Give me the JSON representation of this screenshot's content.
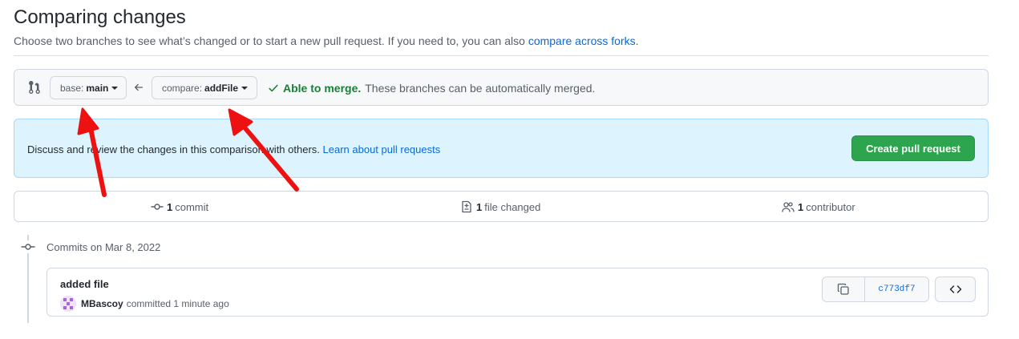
{
  "header": {
    "title": "Comparing changes",
    "subtitle_text": "Choose two branches to see what’s changed or to start a new pull request. If you need to, you can also ",
    "subtitle_link": "compare across forks",
    "subtitle_end": "."
  },
  "range": {
    "base_prefix": "base:",
    "base_branch": "main",
    "compare_prefix": "compare:",
    "compare_branch": "addFile",
    "merge_ok": "Able to merge.",
    "merge_text": "These branches can be automatically merged."
  },
  "flash": {
    "text": "Discuss and review the changes in this comparison with others. ",
    "link": "Learn about pull requests",
    "button": "Create pull request"
  },
  "summary": {
    "commits_count": "1",
    "commits_label": "commit",
    "files_count": "1",
    "files_label": "file changed",
    "contributors_count": "1",
    "contributors_label": "contributor"
  },
  "commits": {
    "heading": "Commits on Mar 8, 2022",
    "items": [
      {
        "title": "added file",
        "author": "MBascoy",
        "meta": "committed 1 minute ago",
        "sha": "c773df7"
      }
    ]
  },
  "colors": {
    "accent_green": "#2da44e",
    "link_blue": "#0969da",
    "annotation_red": "#ee1111"
  }
}
